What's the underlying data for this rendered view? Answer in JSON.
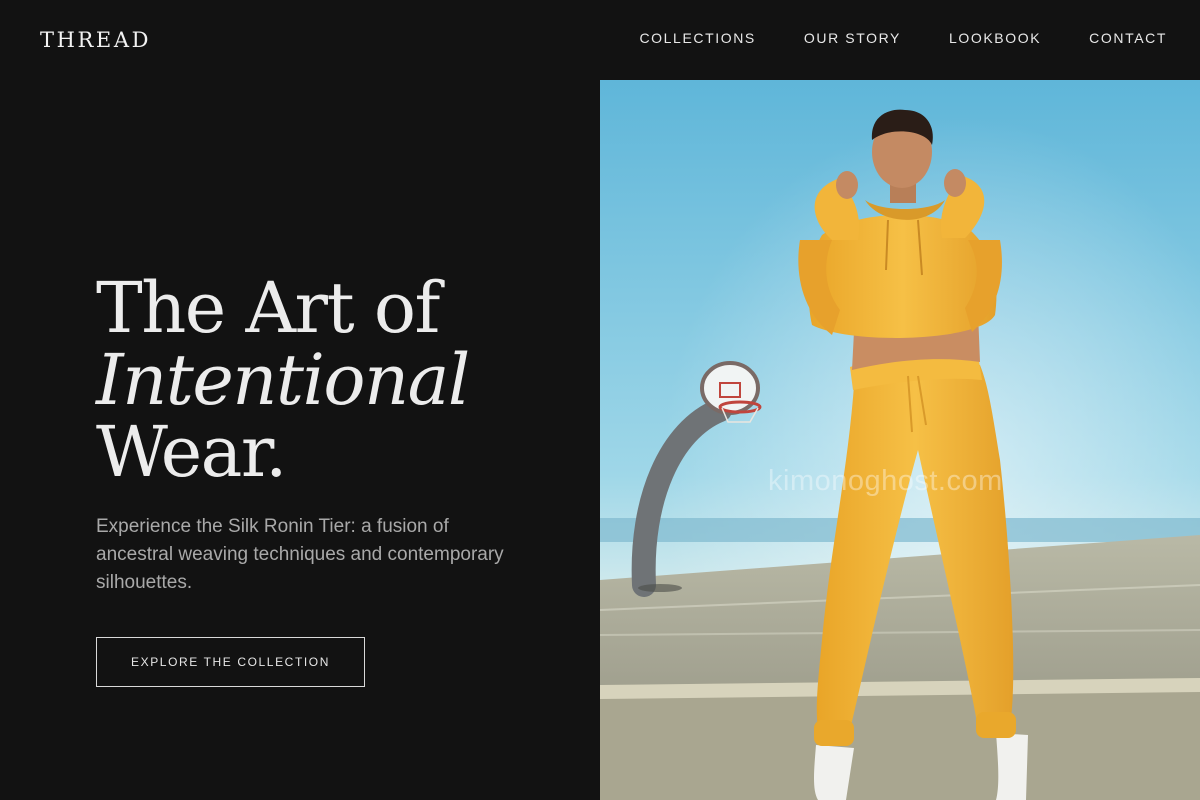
{
  "brand": {
    "logo_text": "THREAD"
  },
  "nav": {
    "items": [
      {
        "label": "COLLECTIONS"
      },
      {
        "label": "OUR STORY"
      },
      {
        "label": "LOOKBOOK"
      },
      {
        "label": "CONTACT"
      }
    ]
  },
  "hero": {
    "title_line1": "The Art of",
    "title_line2": "Intentional",
    "title_line3": "Wear.",
    "description": "Experience the Silk Ronin Tier: a fusion of ancestral weaving techniques and contemporary silhouettes.",
    "cta_label": "EXPLORE THE COLLECTION",
    "image_watermark": "kimonoghost.com"
  },
  "colors": {
    "background": "#121212",
    "text_primary": "#ececec",
    "text_secondary": "#a9a9a9",
    "sky": "#6fc4de",
    "garment": "#f2b53a"
  }
}
